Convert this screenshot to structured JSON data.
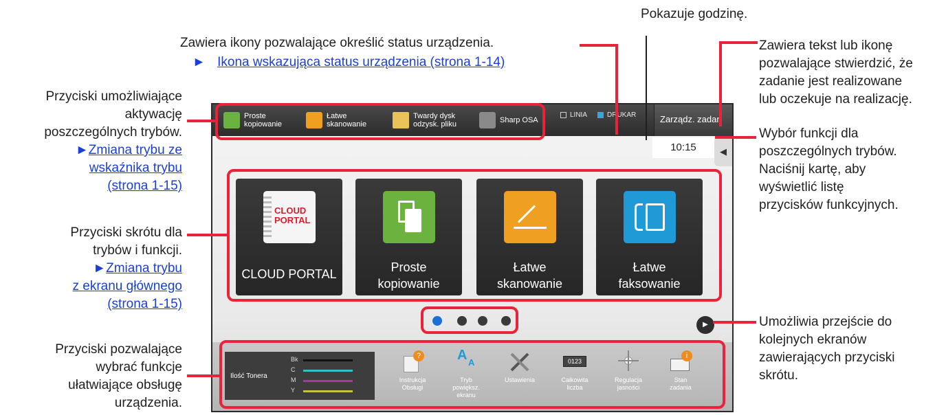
{
  "annotations": {
    "clock_note": "Pokazuje godzinę.",
    "status_icons_note": "Zawiera ikony pozwalające określić status urządzenia.",
    "status_icons_link": "Ikona wskazująca status urządzenia (strona 1-14)",
    "job_note": [
      "Zawiera tekst lub ikonę",
      "pozwalające stwierdzić, że",
      "zadanie jest realizowane",
      "lub oczekuje na realizację."
    ],
    "mode_buttons_note": [
      "Przyciski umożliwiające",
      "aktywację",
      "poszczególnych trybów."
    ],
    "mode_buttons_link": [
      "Zmiana trybu ze",
      "wskaźnika trybu",
      "(strona 1-15)"
    ],
    "function_tab_note": [
      "Wybór funkcji dla",
      "poszczególnych trybów.",
      "Naciśnij kartę, aby",
      "wyświetlić listę",
      "przycisków funkcyjnych."
    ],
    "shortcut_note": [
      "Przyciski skrótu dla",
      "trybów i funkcji."
    ],
    "shortcut_link": [
      "Zmiana trybu",
      "z ekranu głównego",
      "(strona 1-15)"
    ],
    "next_note": [
      "Umożliwia przejście do",
      "kolejnych ekranów",
      "zawierających przyciski",
      "skrótu."
    ],
    "helper_note": [
      "Przyciski pozwalające",
      "wybrać funkcje",
      "ułatwiające obsługę",
      "urządzenia."
    ],
    "arrow": "►"
  },
  "device": {
    "modes": [
      {
        "line1": "Proste",
        "line2": "kopiowanie"
      },
      {
        "line1": "Łatwe",
        "line2": "skanowanie"
      },
      {
        "line1": "Twardy dysk",
        "line2": "odzysk. pliku"
      },
      {
        "line1": "Sharp OSA",
        "line2": ""
      }
    ],
    "status": {
      "line": "LINIA",
      "printer": "DRUKAR"
    },
    "job_button": "Zarządz. zadan",
    "clock": "10:15",
    "shortcuts": [
      {
        "label1": "CLOUD PORTAL",
        "label2": "",
        "logo1": "CLOUD",
        "logo2": "PORTAL"
      },
      {
        "label1": "Proste",
        "label2": "kopiowanie"
      },
      {
        "label1": "Łatwe",
        "label2": "skanowanie"
      },
      {
        "label1": "Łatwe",
        "label2": "faksowanie"
      }
    ],
    "toner": {
      "title": "Ilość Tonera",
      "colors": [
        "Bk",
        "C",
        "M",
        "Y"
      ]
    },
    "functions": [
      {
        "line1": "Instrukcja",
        "line2": "Obsługi",
        "line3": ""
      },
      {
        "line1": "Tryb",
        "line2": "powiększ.",
        "line3": "ekranu"
      },
      {
        "line1": "Ustawienia",
        "line2": "",
        "line3": ""
      },
      {
        "line1": "Całkowita",
        "line2": "liczba",
        "line3": ""
      },
      {
        "line1": "Regulacja",
        "line2": "jasności",
        "line3": ""
      },
      {
        "line1": "Stan",
        "line2": "zadania",
        "line3": ""
      }
    ],
    "counter_digits": "0123"
  },
  "colors": {
    "highlight": "#e8233a",
    "link": "#1a3fd6",
    "active_dot": "#1b6fd6"
  }
}
